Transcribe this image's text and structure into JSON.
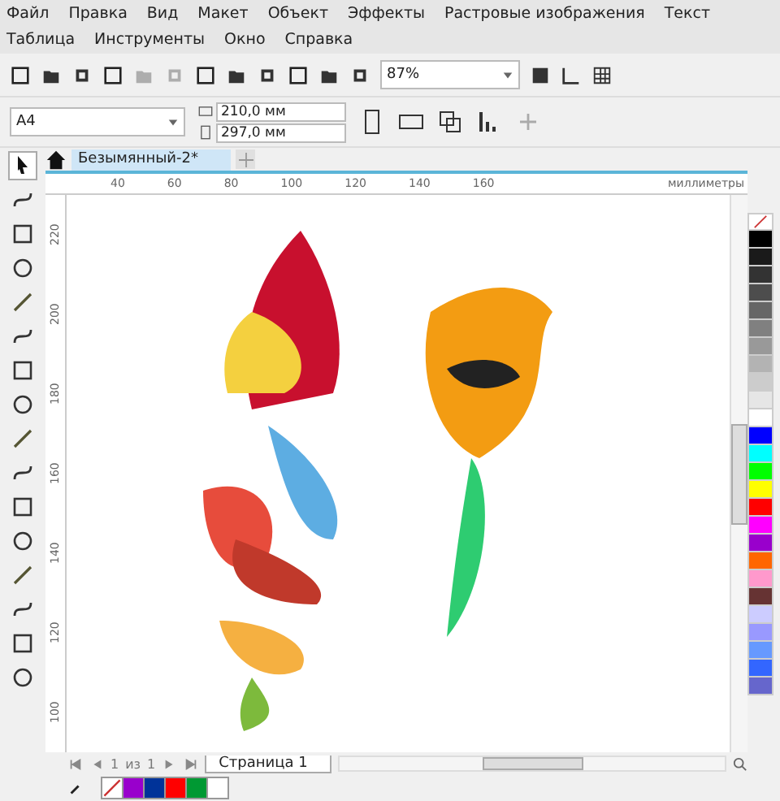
{
  "menu": [
    "Файл",
    "Правка",
    "Вид",
    "Макет",
    "Объект",
    "Эффекты",
    "Растровые изображения",
    "Текст",
    "Таблица",
    "Инструменты",
    "Окно",
    "Справка"
  ],
  "toolbar": {
    "zoom": "87%"
  },
  "property_bar": {
    "page_size": "A4",
    "width": "210,0 мм",
    "height": "297,0 мм"
  },
  "document_tabs": [
    {
      "title": "Безымянный-2*",
      "selected": true
    }
  ],
  "horizontal_ruler": {
    "labels": [
      "40",
      "60",
      "80",
      "100",
      "120",
      "140",
      "160"
    ],
    "unit": "миллиметры"
  },
  "vertical_ruler": {
    "labels": [
      "220",
      "200",
      "180",
      "160",
      "140",
      "120",
      "100"
    ]
  },
  "page_navigator": {
    "current": "1",
    "of": "из",
    "total": "1",
    "page_tab": "Страница 1"
  },
  "color_palette": [
    {
      "kind": "none"
    },
    {
      "kind": "color",
      "color": "#000000"
    },
    {
      "kind": "color",
      "color": "#1a1a1a"
    },
    {
      "kind": "color",
      "color": "#333333"
    },
    {
      "kind": "color",
      "color": "#4d4d4d"
    },
    {
      "kind": "color",
      "color": "#666666"
    },
    {
      "kind": "color",
      "color": "#808080"
    },
    {
      "kind": "color",
      "color": "#999999"
    },
    {
      "kind": "color",
      "color": "#b3b3b3"
    },
    {
      "kind": "color",
      "color": "#cccccc"
    },
    {
      "kind": "color",
      "color": "#e6e6e6"
    },
    {
      "kind": "color",
      "color": "#ffffff"
    },
    {
      "kind": "color",
      "color": "#0000ff"
    },
    {
      "kind": "color",
      "color": "#00ffff"
    },
    {
      "kind": "color",
      "color": "#00ff00"
    },
    {
      "kind": "color",
      "color": "#ffff00"
    },
    {
      "kind": "color",
      "color": "#ff0000"
    },
    {
      "kind": "color",
      "color": "#ff00ff"
    },
    {
      "kind": "color",
      "color": "#9900cc"
    },
    {
      "kind": "color",
      "color": "#ff6600"
    },
    {
      "kind": "color",
      "color": "#ff99cc"
    },
    {
      "kind": "color",
      "color": "#663333"
    },
    {
      "kind": "color",
      "color": "#ccccff"
    },
    {
      "kind": "color",
      "color": "#9999ff"
    },
    {
      "kind": "color",
      "color": "#6699ff"
    },
    {
      "kind": "color",
      "color": "#3366ff"
    },
    {
      "kind": "color",
      "color": "#6666cc"
    }
  ],
  "document_palette": [
    {
      "kind": "none"
    },
    {
      "kind": "color",
      "color": "#9900cc"
    },
    {
      "kind": "color",
      "color": "#003399"
    },
    {
      "kind": "color",
      "color": "#ff0000"
    },
    {
      "kind": "color",
      "color": "#009933"
    },
    {
      "kind": "color",
      "color": "#ffffff"
    }
  ]
}
